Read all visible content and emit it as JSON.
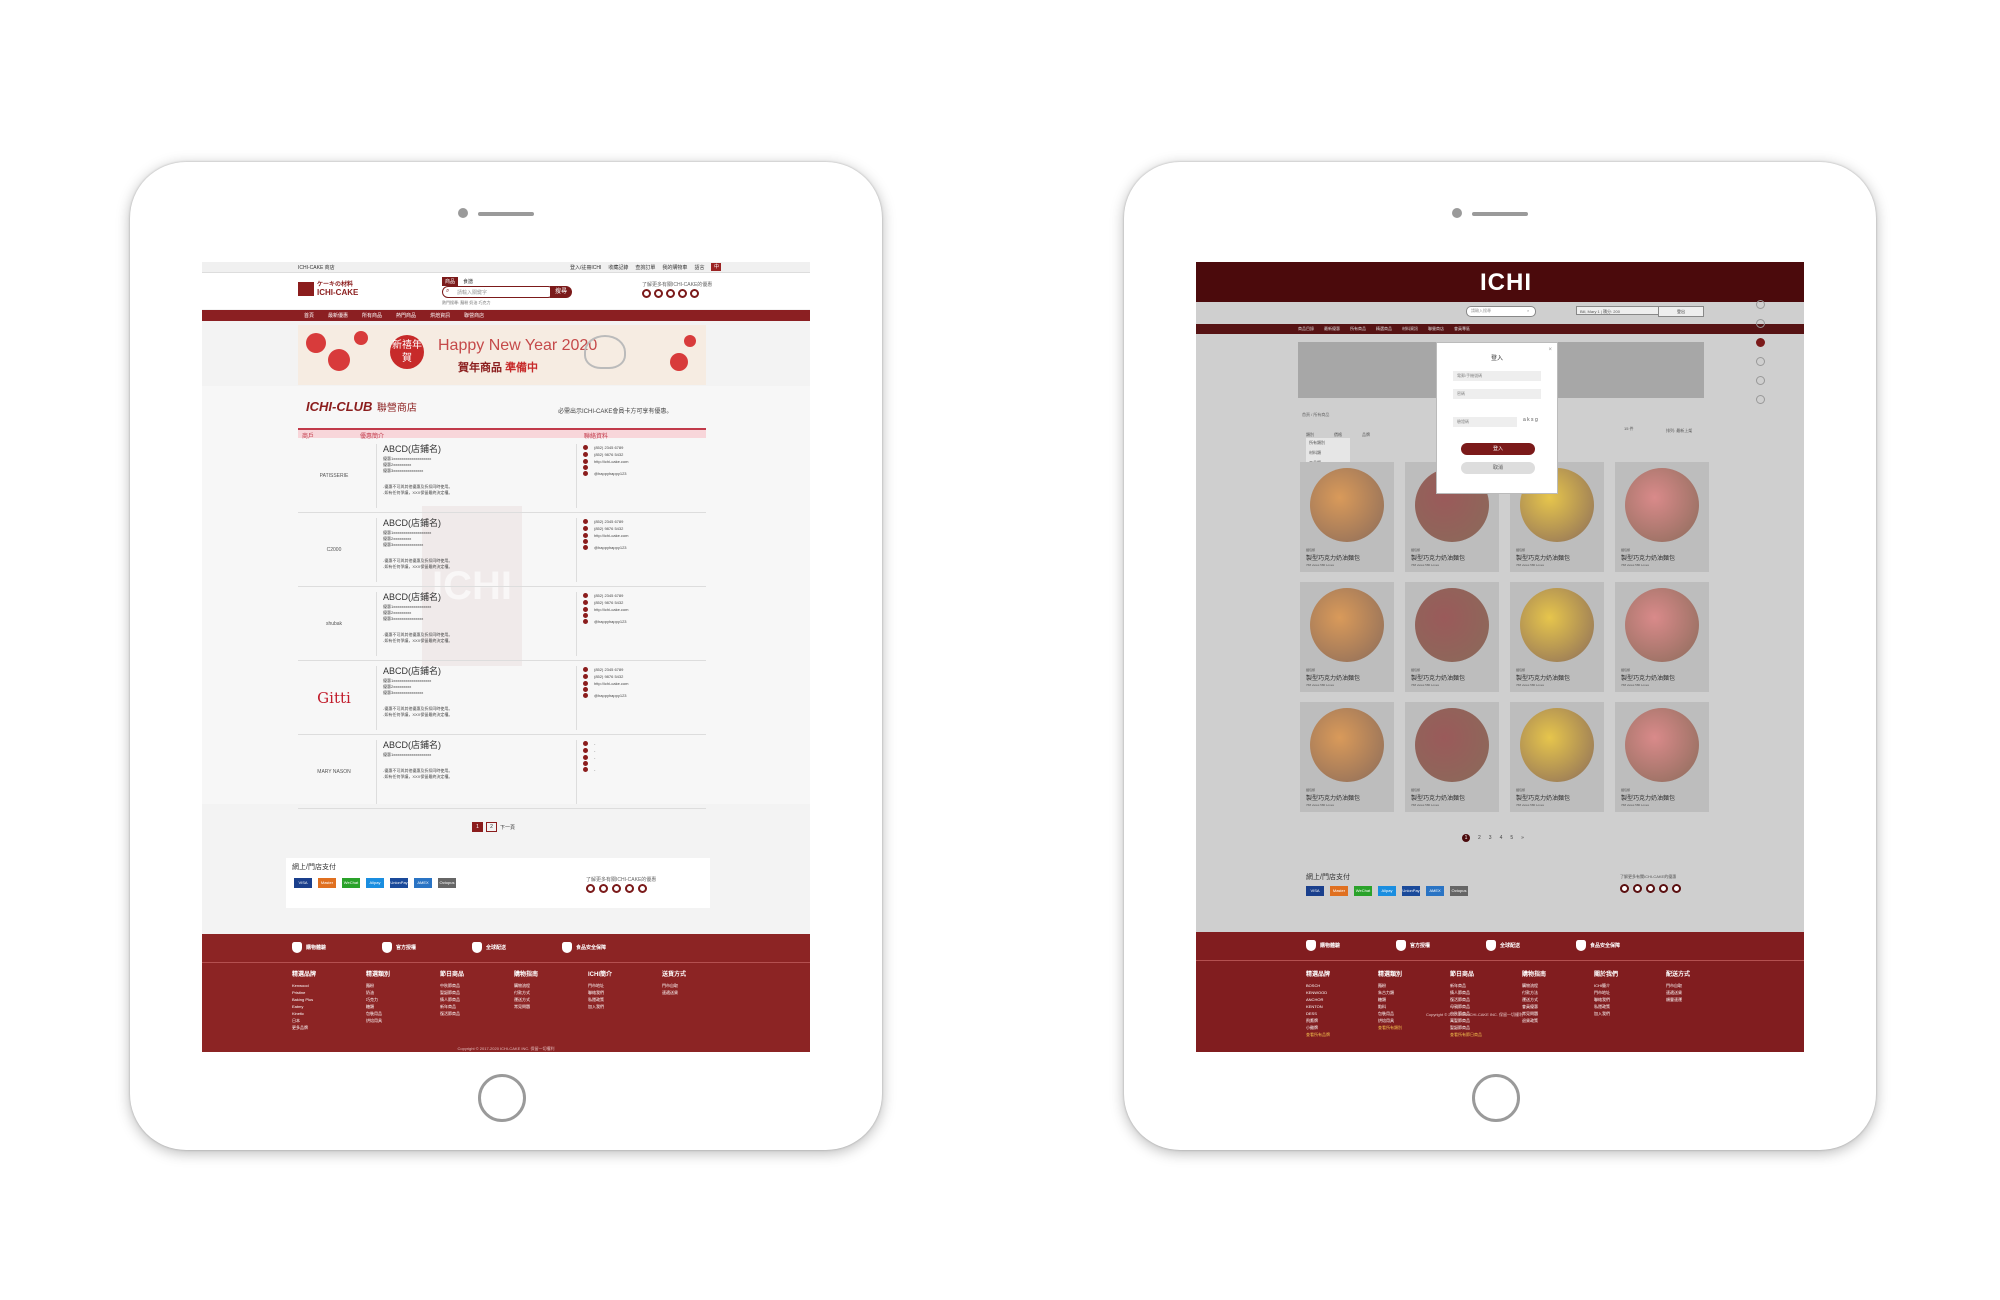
{
  "left": {
    "topbar": {
      "brand": "ICHI-CAKE 商店",
      "links": [
        "登入/註冊ICHI",
        "收藏記錄",
        "查詢訂單",
        "我的購物車",
        "語言"
      ],
      "lang": "中"
    },
    "logo": {
      "jp": "ケーキの材料",
      "en": "ICHI-CAKE"
    },
    "search": {
      "tab_products": "商品",
      "tab_shops": "食譜",
      "placeholder": "請輸入關鍵字",
      "button": "搜尋",
      "hot": "熱門搜尋: 麵粉 奶油 巧克力"
    },
    "social_note": "了解更多有關ICHI-CAKE的優惠",
    "nav": [
      "首頁",
      "最新優惠",
      "所有商品",
      "熱門商品",
      "烘焙資訊",
      "聯營商店"
    ],
    "banner": {
      "badge": "新禧年賀",
      "title": "Happy New Year 2020",
      "subtitle": "賀年商品",
      "highlight": "準備中"
    },
    "club": {
      "title": "ICHI-CLUB",
      "subtitle": "聯營商店",
      "note": "必需出示ICHI-CAKE會員卡方可享有優惠。"
    },
    "table_head": {
      "shop": "商戶",
      "offer": "優惠簡介",
      "contact": "聯絡資料"
    },
    "shops": [
      {
        "logo": "PATISSERIE",
        "name": "ABCD(店鋪名)",
        "offers": [
          "優惠1xxxxxxxxxxxxxxxxxxx",
          "優惠2xxxxxxxxx",
          "優惠3xxxxxxxxxxxxxxx"
        ],
        "terms": [
          "-優惠不可與其他優惠及折扣同時使用。",
          "-如有任何爭議，XXX保留最終決定權。"
        ],
        "phone": "(852) 2345 6789",
        "whatsapp": "(852) 9876 5432",
        "web": "http://ichi-cake.com",
        "fb": "@happyhappy123"
      },
      {
        "logo": "C2000",
        "name": "ABCD(店鋪名)",
        "offers": [
          "優惠1xxxxxxxxxxxxxxxxxxx",
          "優惠2xxxxxxxxx",
          "優惠3xxxxxxxxxxxxxxx"
        ],
        "terms": [
          "-優惠不可與其他優惠及折扣同時使用。",
          "-如有任何爭議，XXX保留最終決定權。"
        ],
        "phone": "(852) 2345 6789",
        "whatsapp": "(852) 9876 5432",
        "web": "http://ichi-cake.com",
        "fb": "@happyhappy123"
      },
      {
        "logo": "shubak",
        "name": "ABCD(店鋪名)",
        "offers": [
          "優惠1xxxxxxxxxxxxxxxxxxx",
          "優惠2xxxxxxxxx",
          "優惠3xxxxxxxxxxxxxxx"
        ],
        "terms": [
          "-優惠不可與其他優惠及折扣同時使用。",
          "-如有任何爭議，XXX保留最終決定權。"
        ],
        "phone": "(852) 2345 6789",
        "whatsapp": "(852) 9876 5432",
        "web": "http://ichi-cake.com",
        "fb": "@happyhappy123"
      },
      {
        "logo": "Gitti",
        "name": "ABCD(店鋪名)",
        "offers": [
          "優惠1xxxxxxxxxxxxxxxxxxx",
          "優惠2xxxxxxxxx",
          "優惠3xxxxxxxxxxxxxxx"
        ],
        "terms": [
          "-優惠不可與其他優惠及折扣同時使用。",
          "-如有任何爭議，XXX保留最終決定權。"
        ],
        "phone": "(852) 2345 6789",
        "whatsapp": "(852) 9876 5432",
        "web": "http://ichi-cake.com",
        "fb": "@happyhappy123"
      },
      {
        "logo": "MARY NASON",
        "name": "ABCD(店鋪名)",
        "offers": [
          "優惠1xxxxxxxxxxxxxxxxxxx"
        ],
        "terms": [
          "-優惠不可與其他優惠及折扣同時使用。",
          "-如有任何爭議，XXX保留最終決定權。"
        ],
        "phone": "-",
        "whatsapp": "-",
        "web": "-",
        "fb": "-"
      }
    ],
    "watermark": "ICHI",
    "pager": {
      "p1": "1",
      "p2": "2",
      "next": "下一頁"
    },
    "payment": {
      "title": "網上/門店支付",
      "cards": [
        "VISA",
        "Master",
        "WeChat",
        "Alipay",
        "UnionPay",
        "AMEX",
        "Octopus"
      ],
      "social_note": "了解更多有關ICHI-CAKE的優惠"
    },
    "footer": {
      "bars": [
        "購物體驗",
        "官方授權",
        "全球配送",
        "食品安全保障"
      ],
      "cols": [
        {
          "h": "精選品牌",
          "items": [
            "Kenwood",
            "Pristine",
            "Baking Plus",
            "Eatmy",
            "Kinetic",
            "日本",
            "更多品牌"
          ]
        },
        {
          "h": "精選類別",
          "items": [
            "麵粉",
            "奶油",
            "巧克力",
            "糖類",
            "包裝用品",
            "烘焙用具"
          ]
        },
        {
          "h": "節日商品",
          "items": [
            "中秋節商品",
            "聖誕節商品",
            "情人節商品",
            "新年商品",
            "復活節商品"
          ]
        },
        {
          "h": "購物指南",
          "items": [
            "購物流程",
            "付款方式",
            "運送方式",
            "常見問題"
          ]
        },
        {
          "h": "ICHI簡介",
          "items": [
            "門市地址",
            "聯絡我們",
            "私隱政策",
            "加入我們"
          ]
        },
        {
          "h": "送貨方式",
          "items": [
            "門市自取",
            "速遞送貨"
          ]
        }
      ],
      "copyright": "Copyright © 2017-2020 ICHI-CAKE INC. 保留一切權利"
    }
  },
  "right": {
    "logo": "ICHI",
    "search_placeholder": "請輸入搜尋",
    "user_info": "Bill, Mary 1 | 積分: 200",
    "user_btn": "登出",
    "nav": [
      "商品目錄",
      "最新優惠",
      "所有商品",
      "精選商品",
      "材料資訊",
      "聯營商店",
      "會員專區"
    ],
    "breadcrumb": "首頁 / 所有商品",
    "filter_tabs": [
      "類別",
      "價格",
      "品牌"
    ],
    "filter_items": [
      "所有類別",
      "材料類",
      "工具類",
      "包裝類"
    ],
    "result_count": "15 件",
    "sort": "排列: 最新上架",
    "products": [
      {
        "cat": "麵包類",
        "name": "製型巧克力奶油麵包",
        "meta": "768 views  580 Loves",
        "color": "#d99a5a"
      },
      {
        "cat": "麵包類",
        "name": "製型巧克力奶油麵包",
        "meta": "768 views  580 Loves",
        "color": "#9a5a5a"
      },
      {
        "cat": "麵包類",
        "name": "製型巧克力奶油麵包",
        "meta": "768 views  580 Loves",
        "color": "#e6c54c"
      },
      {
        "cat": "麵包類",
        "name": "製型巧克力奶油麵包",
        "meta": "768 views  580 Loves",
        "color": "#d98a8a"
      },
      {
        "cat": "麵包類",
        "name": "製型巧克力奶油麵包",
        "meta": "768 views  580 Loves",
        "color": "#d99a5a"
      },
      {
        "cat": "麵包類",
        "name": "製型巧克力奶油麵包",
        "meta": "768 views  580 Loves",
        "color": "#9a5a5a"
      },
      {
        "cat": "麵包類",
        "name": "製型巧克力奶油麵包",
        "meta": "768 views  580 Loves",
        "color": "#e6c54c"
      },
      {
        "cat": "麵包類",
        "name": "製型巧克力奶油麵包",
        "meta": "768 views  580 Loves",
        "color": "#d98a8a"
      },
      {
        "cat": "麵包類",
        "name": "製型巧克力奶油麵包",
        "meta": "768 views  580 Loves",
        "color": "#d99a5a"
      },
      {
        "cat": "麵包類",
        "name": "製型巧克力奶油麵包",
        "meta": "768 views  580 Loves",
        "color": "#9a5a5a"
      },
      {
        "cat": "麵包類",
        "name": "製型巧克力奶油麵包",
        "meta": "768 views  580 Loves",
        "color": "#e6c54c"
      },
      {
        "cat": "麵包類",
        "name": "製型巧克力奶油麵包",
        "meta": "768 views  580 Loves",
        "color": "#d98a8a"
      }
    ],
    "login_modal": {
      "title": "登入",
      "email": "電郵/手機號碼",
      "password": "密碼",
      "captcha": "驗證碼",
      "captcha_img": "a k s g",
      "login": "登入",
      "cancel": "取消"
    },
    "pager": [
      "1",
      "2",
      "3",
      "4",
      "5",
      "»"
    ],
    "payment": {
      "title": "網上/門店支付",
      "cards": [
        "VISA",
        "Master",
        "WeChat",
        "Alipay",
        "UnionPay",
        "AMEX",
        "Octopus"
      ],
      "social_note": "了解更多有關ICHI-CAKE的優惠"
    },
    "footer": {
      "bars": [
        "購物體驗",
        "官方授權",
        "全球配送",
        "食品安全保障"
      ],
      "cols": [
        {
          "h": "精選品牌",
          "items": [
            "BOSCH",
            "KENWOOD",
            "ANCHOR",
            "KENTON",
            "DESS",
            "飛鷹牌",
            "小雞牌",
            "查看所有品牌"
          ]
        },
        {
          "h": "精選類別",
          "items": [
            "麵粉",
            "朱古力類",
            "糖類",
            "餡料",
            "包裝用品",
            "烘焙用具",
            "查看所有類別"
          ]
        },
        {
          "h": "節日商品",
          "items": [
            "新年商品",
            "情人節商品",
            "復活節商品",
            "母親節商品",
            "中秋節商品",
            "萬聖節商品",
            "聖誕節商品",
            "查看所有節日商品"
          ]
        },
        {
          "h": "購物指南",
          "items": [
            "購物流程",
            "付款方法",
            "運送方式",
            "會員優惠",
            "常見問題",
            "退貨政策"
          ]
        },
        {
          "h": "關於我們",
          "items": [
            "ICHI簡介",
            "門市地址",
            "聯絡我們",
            "私隱政策",
            "加入我們"
          ]
        },
        {
          "h": "配送方式",
          "items": [
            "門市自取",
            "速遞送貨",
            "順豐速運"
          ]
        }
      ],
      "copyright": "Copyright © 2017-2020 ICHI-CAKE INC. 保留一切權利"
    }
  }
}
